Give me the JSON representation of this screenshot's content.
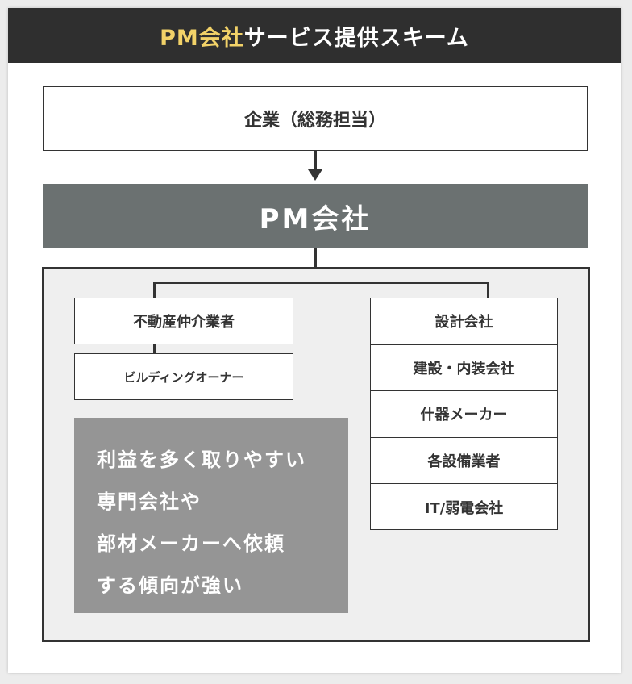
{
  "header": {
    "title_accent": "PM会社",
    "title_rest": "サービス提供スキーム"
  },
  "top_box": "企業（総務担当）",
  "pm_band": "PM会社",
  "left_nodes": [
    "不動産仲介業者",
    "ビルディングオーナー"
  ],
  "right_nodes": [
    "設計会社",
    "建設・内装会社",
    "什器メーカー",
    "各設備業者",
    "IT/弱電会社"
  ],
  "note_lines": [
    "利益を多く取りやすい",
    "専門会社や",
    "部材メーカーへ依頼",
    "する傾向が強い"
  ],
  "colors": {
    "header_bg": "#2f2f2f",
    "accent": "#f2d268",
    "pm_band": "#6b7171",
    "note_bg": "#959595",
    "frame_bg": "#efefef"
  }
}
